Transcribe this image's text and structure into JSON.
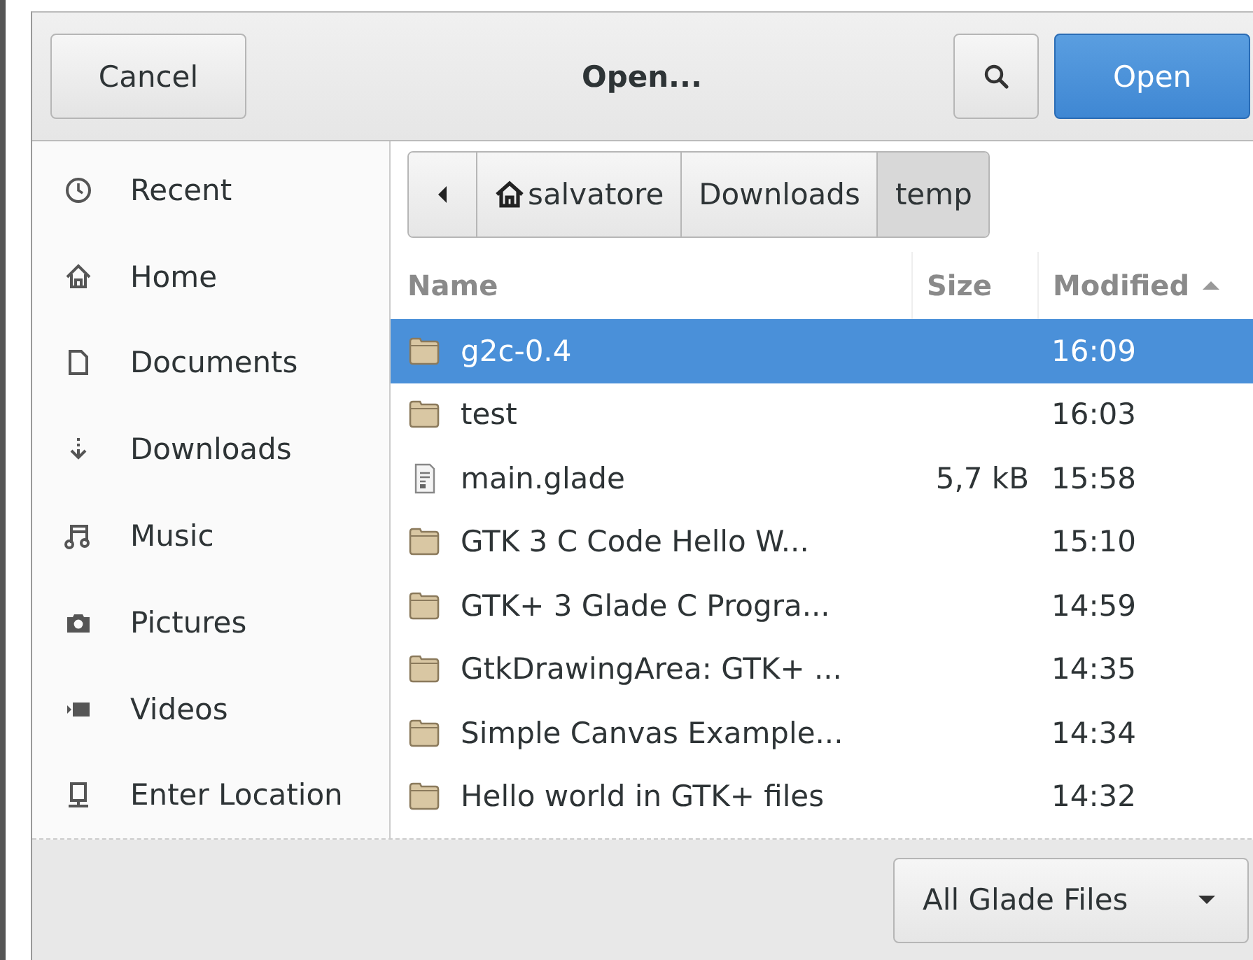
{
  "header": {
    "cancel": "Cancel",
    "title": "Open...",
    "open": "Open"
  },
  "sidebar": {
    "items": [
      {
        "kind": "recent",
        "label": "Recent"
      },
      {
        "kind": "home",
        "label": "Home"
      },
      {
        "kind": "document",
        "label": "Documents"
      },
      {
        "kind": "download",
        "label": "Downloads"
      },
      {
        "kind": "music",
        "label": "Music"
      },
      {
        "kind": "camera",
        "label": "Pictures"
      },
      {
        "kind": "video",
        "label": "Videos"
      },
      {
        "kind": "location",
        "label": "Enter Location"
      }
    ]
  },
  "path_bar": [
    {
      "label": "salvatore",
      "home": true,
      "selected": false
    },
    {
      "label": "Downloads",
      "home": false,
      "selected": false
    },
    {
      "label": "temp",
      "home": false,
      "selected": true
    }
  ],
  "table": {
    "columns": [
      "Name",
      "Size",
      "Modified"
    ],
    "rows": [
      {
        "kind": "folder",
        "name": "g2c-0.4",
        "size": "",
        "modified": "16:09",
        "selected": true
      },
      {
        "kind": "folder",
        "name": "test",
        "size": "",
        "modified": "16:03",
        "selected": false
      },
      {
        "kind": "file",
        "name": "main.glade",
        "size": "5,7 kB",
        "modified": "15:58",
        "selected": false
      },
      {
        "kind": "folder",
        "name": "GTK 3 C Code Hello W...",
        "size": "",
        "modified": "15:10",
        "selected": false
      },
      {
        "kind": "folder",
        "name": "GTK+ 3 Glade C Progra...",
        "size": "",
        "modified": "14:59",
        "selected": false
      },
      {
        "kind": "folder",
        "name": "GtkDrawingArea: GTK+ ...",
        "size": "",
        "modified": "14:35",
        "selected": false
      },
      {
        "kind": "folder",
        "name": "Simple Canvas Example...",
        "size": "",
        "modified": "14:34",
        "selected": false
      },
      {
        "kind": "folder",
        "name": "Hello world in GTK+ files",
        "size": "",
        "modified": "14:32",
        "selected": false
      }
    ]
  },
  "filter": {
    "value": "All Glade Files"
  }
}
